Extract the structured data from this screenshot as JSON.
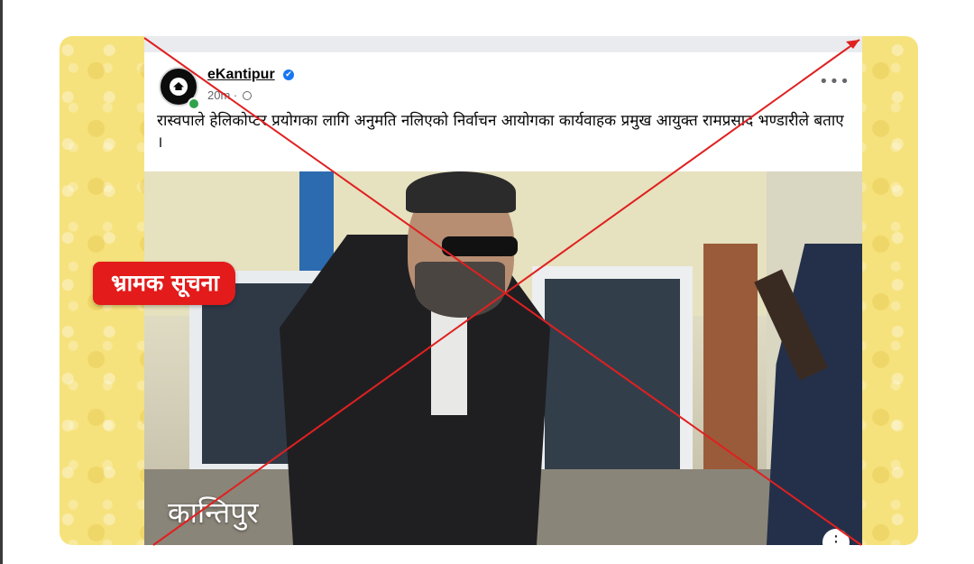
{
  "post": {
    "page_name": "eKantipur",
    "time": "20m ·",
    "text": "रास्वपाले हेलिकोप्टर प्रयोगका लागि अनुमति नलिएको निर्वाचन आयोगका कार्यवाहक प्रमुख आयुक्त रामप्रसाद भण्डारीले बताए ।",
    "more_label": "•••"
  },
  "photo": {
    "watermark": "कान्तिपुर"
  },
  "badge": {
    "label": "भ्रामक सूचना",
    "color": "#e31b1b"
  },
  "icons": {
    "verified": "verified-badge-icon",
    "globe": "globe-icon",
    "more": "more-options-icon",
    "photo_menu": "photo-menu-icon"
  },
  "colors": {
    "frame": "#f6e27c",
    "cross_lines": "#e02020"
  }
}
